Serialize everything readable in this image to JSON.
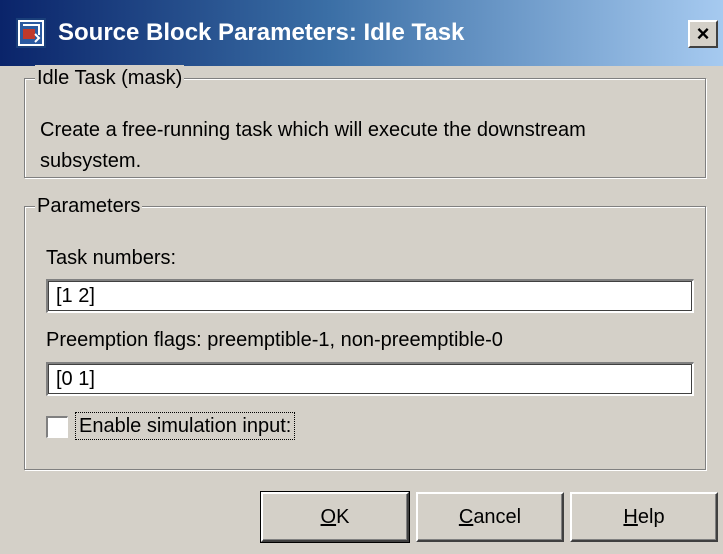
{
  "window": {
    "title": "Source Block Parameters: Idle Task",
    "close_glyph": "×"
  },
  "mask_group": {
    "legend": "Idle Task (mask)",
    "description": "Create a free-running task which will execute the downstream subsystem."
  },
  "parameters_group": {
    "legend": "Parameters",
    "task_numbers_label": "Task numbers:",
    "task_numbers_value": "[1 2]",
    "preemption_label": "Preemption flags: preemptible-1, non-preemptible-0",
    "preemption_value": "[0 1]",
    "enable_sim_label": "Enable simulation input:",
    "enable_sim_checked": false
  },
  "buttons": {
    "ok_mnemonic": "O",
    "ok_rest": "K",
    "cancel_mnemonic": "C",
    "cancel_rest": "ancel",
    "help_mnemonic": "H",
    "help_rest": "elp"
  },
  "colors": {
    "dialog_bg": "#d4d0c8",
    "title_start": "#0a246a",
    "title_end": "#a6caf0"
  }
}
